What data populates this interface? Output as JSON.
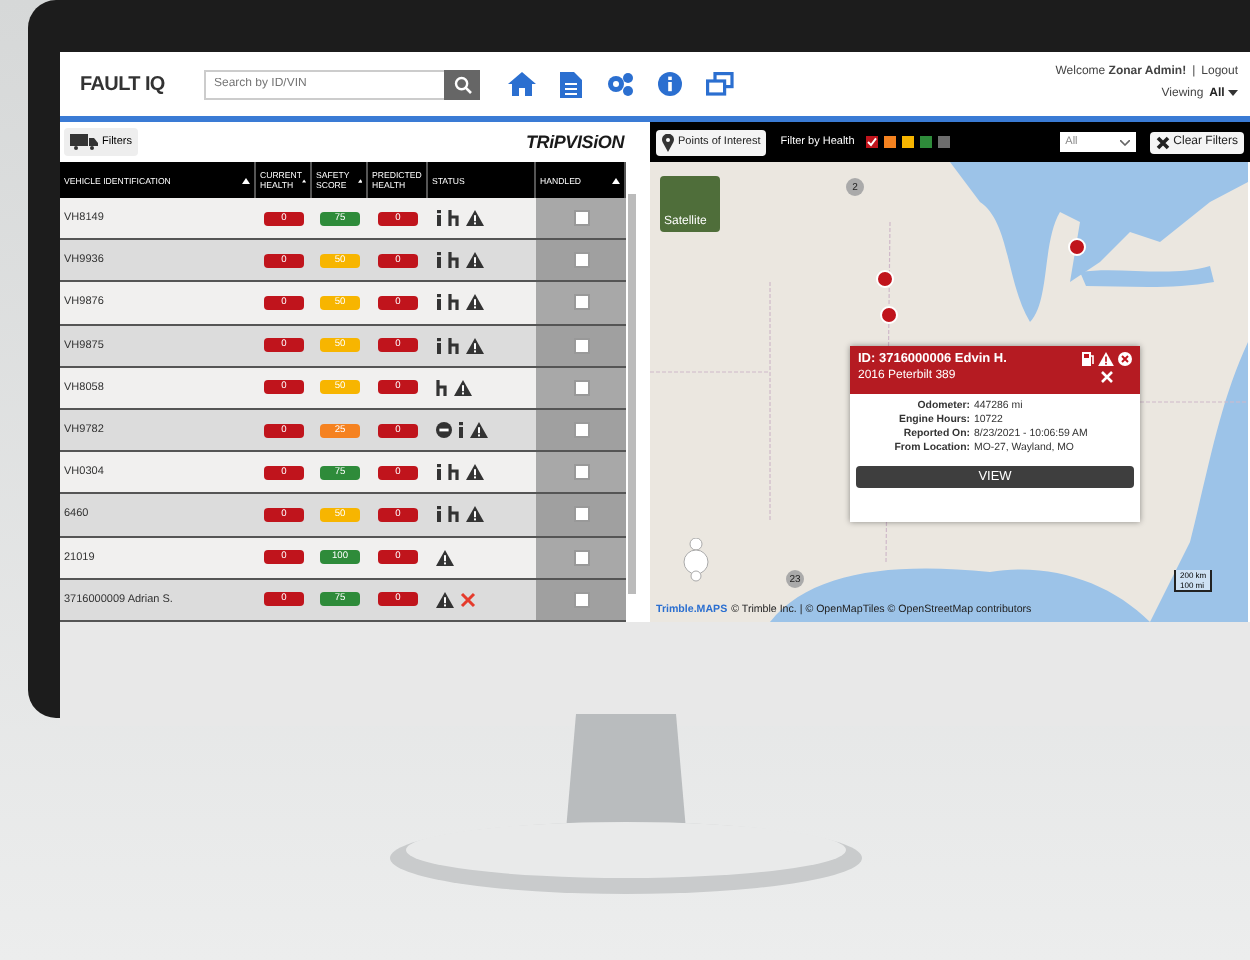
{
  "header": {
    "logo": "FAULT IQ",
    "search": {
      "placeholder": "Search by ID/VIN"
    },
    "welcome": "Welcome **Zonar Admin!**",
    "separator": "|",
    "logout": "Logout",
    "viewing_label": "Viewing",
    "viewing_value": "All"
  },
  "left_toolbar": {
    "filters_button": "Filters",
    "brand": "TRiPVISiON"
  },
  "table": {
    "columns": [
      "VEHICLE IDENTIFICATION",
      "CURRENT HEALTH",
      "SAFETY SCORE",
      "PREDICTED HEALTH",
      "STATUS",
      "HANDLED"
    ],
    "rows": [
      {
        "vehicle": "VH8149",
        "current": "0",
        "safety": {
          "score": "75",
          "color": "#2e8b3a"
        },
        "predicted": "0",
        "status": [
          {
            "kind": "info"
          },
          {
            "kind": "tow"
          },
          {
            "kind": "warning"
          }
        ],
        "handled": false
      },
      {
        "vehicle": "VH9936",
        "current": "0",
        "safety": {
          "score": "50",
          "color": "#f7b500"
        },
        "predicted": "0",
        "status": [
          {
            "kind": "info"
          },
          {
            "kind": "tow"
          },
          {
            "kind": "warning"
          }
        ],
        "handled": false
      },
      {
        "vehicle": "VH9876",
        "current": "0",
        "safety": {
          "score": "50",
          "color": "#f7b500"
        },
        "predicted": "0",
        "status": [
          {
            "kind": "info"
          },
          {
            "kind": "tow"
          },
          {
            "kind": "warning"
          }
        ],
        "handled": false
      },
      {
        "vehicle": "VH9875",
        "current": "0",
        "safety": {
          "score": "50",
          "color": "#f7b500"
        },
        "predicted": "0",
        "status": [
          {
            "kind": "info"
          },
          {
            "kind": "tow"
          },
          {
            "kind": "warning"
          }
        ],
        "handled": false
      },
      {
        "vehicle": "VH8058",
        "current": "0",
        "safety": {
          "score": "50",
          "color": "#f7b500"
        },
        "predicted": "0",
        "status": [
          {
            "kind": "tow"
          },
          {
            "kind": "warning"
          }
        ],
        "handled": false
      },
      {
        "vehicle": "VH9782",
        "current": "0",
        "safety": {
          "score": "25",
          "color": "#f58220"
        },
        "predicted": "0",
        "status": [
          {
            "kind": "minus"
          },
          {
            "kind": "info"
          },
          {
            "kind": "warning"
          }
        ],
        "handled": false
      },
      {
        "vehicle": "VH0304",
        "current": "0",
        "safety": {
          "score": "75",
          "color": "#2e8b3a"
        },
        "predicted": "0",
        "status": [
          {
            "kind": "info"
          },
          {
            "kind": "tow"
          },
          {
            "kind": "warning"
          }
        ],
        "handled": false
      },
      {
        "vehicle": "6460",
        "current": "0",
        "safety": {
          "score": "50",
          "color": "#f7b500"
        },
        "predicted": "0",
        "status": [
          {
            "kind": "info"
          },
          {
            "kind": "tow"
          },
          {
            "kind": "warning"
          }
        ],
        "handled": false
      },
      {
        "vehicle": "21019",
        "current": "0",
        "safety": {
          "score": "100",
          "color": "#2e8b3a"
        },
        "predicted": "0",
        "status": [
          {
            "kind": "warning"
          }
        ],
        "handled": false
      },
      {
        "vehicle": "3716000009 Adrian S.",
        "current": "0",
        "safety": {
          "score": "75",
          "color": "#2e8b3a"
        },
        "predicted": "0",
        "status": [
          {
            "kind": "warning"
          },
          {
            "kind": "tools"
          }
        ],
        "handled": false
      }
    ]
  },
  "map_toolbar": {
    "poi_button": "Points of Interest",
    "filter_label": "Filter by Health",
    "health_filters": [
      {
        "color": "#c0141c",
        "checked": true
      },
      {
        "color": "#f58220",
        "checked": false
      },
      {
        "color": "#f7b500",
        "checked": false
      },
      {
        "color": "#2e8b3a",
        "checked": false
      },
      {
        "color": "#6d6d6d",
        "checked": false
      }
    ],
    "select_value": "All",
    "clear_button": "Clear Filters"
  },
  "map": {
    "satellite_button": "Satellite",
    "clusters": [
      "2",
      "23"
    ],
    "popup": {
      "title": "ID: 3716000006 Edvin H.",
      "subtitle": "2016 Peterbilt 389",
      "fields": [
        {
          "label": "Odometer:",
          "value": "447286 mi"
        },
        {
          "label": "Engine Hours:",
          "value": "10722"
        },
        {
          "label": "Reported On:",
          "value": "8/23/2021 - 10:06:59 AM"
        },
        {
          "label": "From Location:",
          "value": "MO-27, Wayland, MO"
        }
      ],
      "view_button": "VIEW"
    },
    "scale": [
      "200 km",
      "100 mi"
    ],
    "attribution_logo": "Trimble.MAPS",
    "attribution": "© Trimble Inc. | © OpenMapTiles © OpenStreetMap contributors"
  }
}
